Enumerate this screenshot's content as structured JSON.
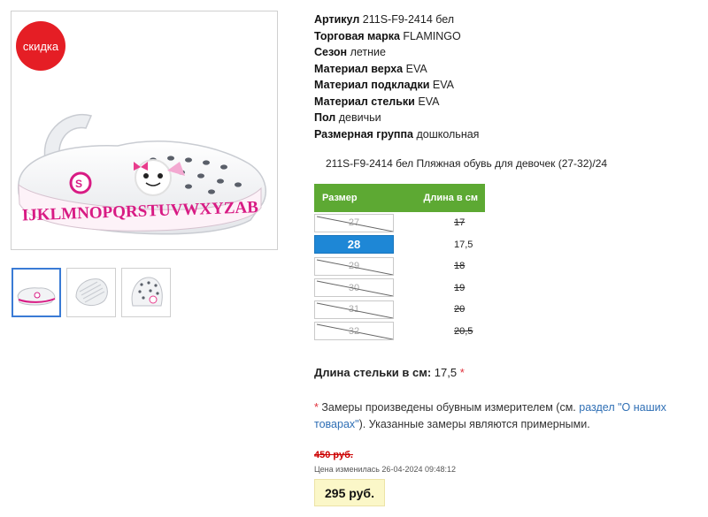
{
  "gallery": {
    "badge": "скидка",
    "thumbs": [
      "side-view",
      "sole-view",
      "top-view"
    ],
    "active_thumb": 0
  },
  "specs": [
    {
      "key": "Артикул",
      "value": "211S-F9-2414 бел"
    },
    {
      "key": "Торговая марка",
      "value": "FLAMINGO"
    },
    {
      "key": "Сезон",
      "value": "летние"
    },
    {
      "key": "Материал верха",
      "value": "EVA"
    },
    {
      "key": "Материал подкладки",
      "value": "EVA"
    },
    {
      "key": "Материал стельки",
      "value": "EVA"
    },
    {
      "key": "Пол",
      "value": "девичьи"
    },
    {
      "key": "Размерная группа",
      "value": "дошкольная"
    }
  ],
  "product_line": "211S-F9-2414 бел Пляжная обувь для девочек (27-32)/24",
  "size_table": {
    "header_size": "Размер",
    "header_length": "Длина в см",
    "rows": [
      {
        "size": "27",
        "length": "17",
        "available": false,
        "selected": false
      },
      {
        "size": "28",
        "length": "17,5",
        "available": true,
        "selected": true
      },
      {
        "size": "29",
        "length": "18",
        "available": false,
        "selected": false
      },
      {
        "size": "30",
        "length": "19",
        "available": false,
        "selected": false
      },
      {
        "size": "31",
        "length": "20",
        "available": false,
        "selected": false
      },
      {
        "size": "32",
        "length": "20,5",
        "available": false,
        "selected": false
      }
    ]
  },
  "insole": {
    "label": "Длина стельки в см:",
    "value": "17,5",
    "mark": "*"
  },
  "note": {
    "mark": "*",
    "text_before": "Замеры произведены обувным измерителем (см.",
    "link": "раздел \"О наших товарах\"",
    "text_after": "). Указанные замеры являются примерными."
  },
  "price": {
    "old": "450 руб.",
    "changed": "Цена изменилась 26-04-2024 09:48:12",
    "new": "295 руб."
  },
  "colors": {
    "accent_green": "#5da933",
    "selected_blue": "#1e87d6",
    "sale_red": "#e51e25",
    "price_bg": "#fbf7c8"
  }
}
